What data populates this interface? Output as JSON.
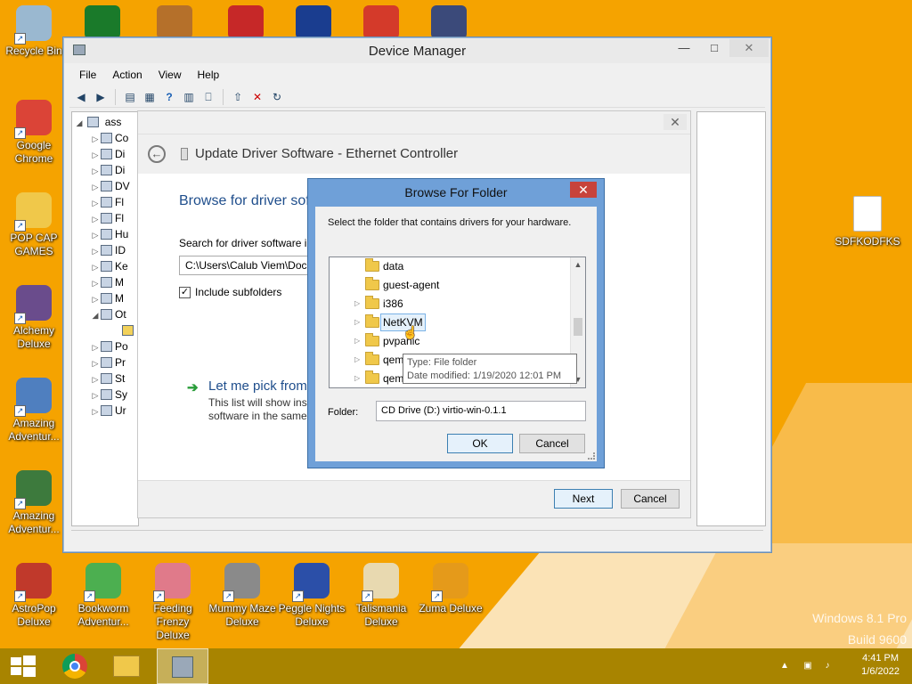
{
  "desktop": {
    "left_icons": [
      {
        "name": "recycle-bin-icon",
        "label": "Recycle Bin",
        "color": "#9ab8d0"
      },
      {
        "name": "google-chrome-icon",
        "label": "Google Chrome",
        "color": "#db4437"
      },
      {
        "name": "pop-cap-games-icon",
        "label": "POP CAP GAMES",
        "color": "#f0c84a"
      },
      {
        "name": "alchemy-deluxe-icon",
        "label": "Alchemy Deluxe",
        "color": "#6a4c8c"
      },
      {
        "name": "amazing-adventures-icon",
        "label": "Amazing Adventur...",
        "color": "#4f7fbf"
      },
      {
        "name": "amazing-adventures-2-icon",
        "label": "Amazing Adventur...",
        "color": "#3d7a3d"
      }
    ],
    "top_icons": [
      {
        "name": "radiation-game-icon",
        "color": "#1a7a2a"
      },
      {
        "name": "bookworm-book-icon",
        "color": "#b5702a"
      },
      {
        "name": "gnome-game-icon",
        "color": "#c62828"
      },
      {
        "name": "mpi-game-icon",
        "color": "#1a3d8f"
      },
      {
        "name": "peggle-icon",
        "color": "#d43a2a"
      },
      {
        "name": "wizard-game-icon",
        "color": "#3b4a7a"
      }
    ],
    "bottom_icons": [
      {
        "name": "astropop-deluxe-icon",
        "label": "AstroPop Deluxe",
        "color": "#c0392b"
      },
      {
        "name": "bookworm-adventures-icon",
        "label": "Bookworm Adventur...",
        "color": "#4caf50"
      },
      {
        "name": "feeding-frenzy-icon",
        "label": "Feeding Frenzy Deluxe",
        "color": "#e07a8a"
      },
      {
        "name": "mummy-maze-icon",
        "label": "Mummy Maze Deluxe",
        "color": "#8a8a8a"
      },
      {
        "name": "peggle-nights-icon",
        "label": "Peggle Nights Deluxe",
        "color": "#2b4fa8"
      },
      {
        "name": "talismania-icon",
        "label": "Talismania Deluxe",
        "color": "#e8d9b0"
      },
      {
        "name": "zuma-deluxe-icon",
        "label": "Zuma Deluxe",
        "color": "#e59a1a"
      }
    ],
    "right_icon": {
      "name": "file-icon",
      "label": "SDFKODFKS"
    },
    "watermark_line1": "Windows 8.1 Pro",
    "watermark_line2": "Build 9600"
  },
  "device_manager": {
    "title": "Device Manager",
    "menu": [
      "File",
      "Action",
      "View",
      "Help"
    ],
    "tree_root": "ass",
    "tree_items": [
      "Co",
      "Di",
      "Di",
      "DV",
      "Fl",
      "Fl",
      "Hu",
      "ID",
      "Ke",
      "M",
      "M",
      "Ot",
      "",
      "Po",
      "Pr",
      "St",
      "Sy",
      "Ur"
    ]
  },
  "wizard": {
    "title": "Update Driver Software - Ethernet Controller",
    "heading": "Browse for driver sof",
    "search_label": "Search for driver software in",
    "path_value": "C:\\Users\\Calub Viem\\Docu",
    "include_subfolders": "Include subfolders",
    "pick_heading": "Let me pick from",
    "pick_desc1": "This list will show inst",
    "pick_desc2": "software in the same",
    "next_label": "Next",
    "cancel_label": "Cancel"
  },
  "browse_dialog": {
    "title": "Browse For Folder",
    "instruction": "Select the folder that contains drivers for your hardware.",
    "folders": [
      {
        "name": "data",
        "expandable": false
      },
      {
        "name": "guest-agent",
        "expandable": false
      },
      {
        "name": "i386",
        "expandable": true
      },
      {
        "name": "NetKVM",
        "expandable": true,
        "selected": true
      },
      {
        "name": "pvpanic",
        "expandable": true
      },
      {
        "name": "qem",
        "expandable": true
      },
      {
        "name": "qem",
        "expandable": true
      }
    ],
    "tooltip_type": "Type: File folder",
    "tooltip_date": "Date modified: 1/19/2020 12:01 PM",
    "folder_label": "Folder:",
    "folder_value": "CD Drive (D:) virtio-win-0.1.1",
    "ok_label": "OK",
    "cancel_label": "Cancel"
  },
  "taskbar": {
    "time": "4:41 PM",
    "date": "1/6/2022"
  }
}
